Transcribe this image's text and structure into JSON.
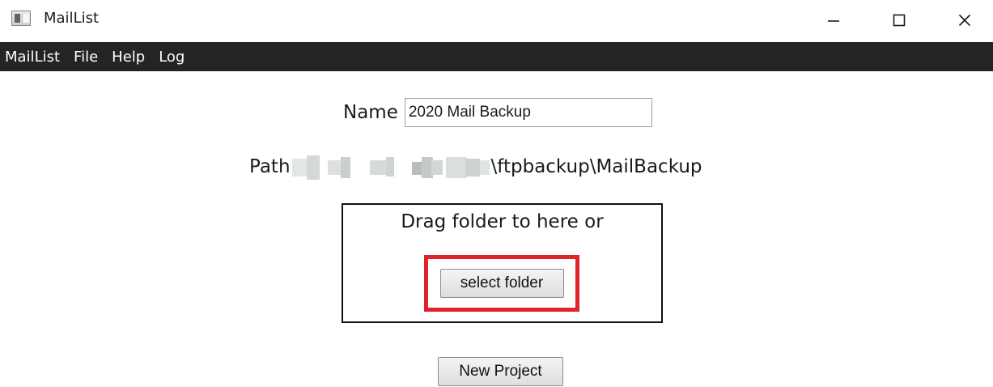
{
  "window": {
    "title": "MailList",
    "icon": "app-window-icon",
    "controls": {
      "minimize_icon": "minimize-icon",
      "maximize_icon": "maximize-icon",
      "close_icon": "close-icon"
    }
  },
  "menu": {
    "items": [
      "MailList",
      "File",
      "Help",
      "Log"
    ]
  },
  "form": {
    "name_label": "Name",
    "name_value": "2020 Mail Backup",
    "path_label": "Path",
    "path_visible_suffix": "\\ftpbackup\\MailBackup"
  },
  "drop_zone": {
    "text": "Drag folder to here or",
    "select_button_label": "select folder"
  },
  "actions": {
    "new_project_label": "New Project"
  },
  "colors": {
    "menubar_bg": "#242424",
    "highlight_border": "#e0242b"
  }
}
